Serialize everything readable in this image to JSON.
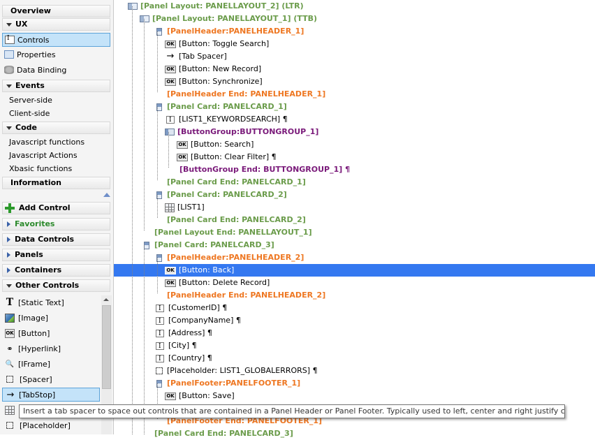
{
  "left": {
    "sections_top": [
      {
        "label": "Overview",
        "kind": "plain"
      },
      {
        "label": "UX",
        "kind": "open"
      }
    ],
    "ux_items": [
      {
        "label": "Controls",
        "icon": "controls-icon",
        "selected": true
      },
      {
        "label": "Properties",
        "icon": "properties-icon"
      },
      {
        "label": "Data Binding",
        "icon": "data-binding-icon"
      }
    ],
    "events_header": "Events",
    "events_items": [
      "Server-side",
      "Client-side"
    ],
    "code_header": "Code",
    "code_items": [
      "Javascript functions",
      "Javascript Actions",
      "Xbasic functions"
    ],
    "information": "Information",
    "add_control": "Add Control",
    "favorites": "Favorites",
    "groups": [
      "Data Controls",
      "Panels",
      "Containers"
    ],
    "other_controls": "Other Controls",
    "controls": [
      {
        "label": "[Static Text]",
        "icon": "static-text-icon"
      },
      {
        "label": "[Image]",
        "icon": "image-icon"
      },
      {
        "label": "[Button]",
        "icon": "button-icon"
      },
      {
        "label": "[Hyperlink]",
        "icon": "hyperlink-icon"
      },
      {
        "label": "[IFrame]",
        "icon": "iframe-icon"
      },
      {
        "label": "[Spacer]",
        "icon": "spacer-icon"
      },
      {
        "label": "[TabStop]",
        "icon": "tabstop-icon",
        "selected": true
      },
      {
        "label": "",
        "icon": "grid-icon"
      },
      {
        "label": "[Placeholder]",
        "icon": "placeholder-icon"
      }
    ]
  },
  "tree": [
    {
      "text": "[Panel Layout: PANELLAYOUT_2] (LTR)",
      "cls": "g",
      "icon": "panel"
    },
    {
      "text": "[Panel Layout: PANELLAYOUT_1] (TTB)",
      "cls": "g",
      "icon": "panel"
    },
    {
      "text": "[PanelHeader:PANELHEADER_1]",
      "cls": "o",
      "icon": "hdr"
    },
    {
      "text": "[Button: Toggle Search]",
      "cls": "",
      "icon": "ok"
    },
    {
      "text": "[Tab Spacer]",
      "cls": "",
      "icon": "arrow"
    },
    {
      "text": "[Button: New Record]",
      "cls": "",
      "icon": "ok"
    },
    {
      "text": "[Button: Synchronize]",
      "cls": "",
      "icon": "ok"
    },
    {
      "text": "[PanelHeader End: PANELHEADER_1]",
      "cls": "o",
      "icon": ""
    },
    {
      "text": "[Panel Card: PANELCARD_1]",
      "cls": "g",
      "icon": "hdr"
    },
    {
      "text": "[LIST1_KEYWORDSEARCH] ¶",
      "cls": "",
      "icon": "ctrl"
    },
    {
      "text": "[ButtonGroup:BUTTONGROUP_1]",
      "cls": "p",
      "icon": "btngrp"
    },
    {
      "text": "[Button: Search]",
      "cls": "",
      "icon": "ok"
    },
    {
      "text": "[Button: Clear Filter] ¶",
      "cls": "",
      "icon": "ok"
    },
    {
      "text": "[ButtonGroup End: BUTTONGROUP_1] ¶",
      "cls": "p",
      "icon": ""
    },
    {
      "text": "[Panel Card End: PANELCARD_1]",
      "cls": "g",
      "icon": ""
    },
    {
      "text": "[Panel Card: PANELCARD_2]",
      "cls": "g",
      "icon": "hdr"
    },
    {
      "text": "[LIST1]",
      "cls": "",
      "icon": "grid"
    },
    {
      "text": "[Panel Card End: PANELCARD_2]",
      "cls": "g",
      "icon": ""
    },
    {
      "text": "[Panel Layout End: PANELLAYOUT_1]",
      "cls": "g",
      "icon": ""
    },
    {
      "text": "[Panel Card: PANELCARD_3]",
      "cls": "g",
      "icon": "hdr"
    },
    {
      "text": "[PanelHeader:PANELHEADER_2]",
      "cls": "o",
      "icon": "hdr"
    },
    {
      "text": "[Button: Back]",
      "cls": "",
      "icon": "ok",
      "selected": true
    },
    {
      "text": "[Button: Delete Record]",
      "cls": "",
      "icon": "ok"
    },
    {
      "text": "[PanelHeader End: PANELHEADER_2]",
      "cls": "o",
      "icon": ""
    },
    {
      "text": "[CustomerID] ¶",
      "cls": "",
      "icon": "ctrl"
    },
    {
      "text": "[CompanyName] ¶",
      "cls": "",
      "icon": "ctrl"
    },
    {
      "text": "[Address] ¶",
      "cls": "",
      "icon": "ctrl"
    },
    {
      "text": "[City] ¶",
      "cls": "",
      "icon": "ctrl"
    },
    {
      "text": "[Country] ¶",
      "cls": "",
      "icon": "ctrl"
    },
    {
      "text": "[Placeholder: LIST1_GLOBALERRORS] ¶",
      "cls": "",
      "icon": "dash"
    },
    {
      "text": "[PanelFooter:PANELFOOTER_1]",
      "cls": "o",
      "icon": "hdr"
    },
    {
      "text": "[Button: Save]",
      "cls": "",
      "icon": "ok"
    },
    {
      "text": "",
      "cls": "",
      "icon": ""
    },
    {
      "text": "[PanelFooter End: PANELFOOTER_1]",
      "cls": "o",
      "icon": ""
    },
    {
      "text": "[Panel Card End: PANELCARD_3]",
      "cls": "g",
      "icon": ""
    }
  ],
  "tooltip": "Insert a tab spacer to space out controls that are contained in a Panel Header or Panel Footer. Typically used to left, center and right justify controls."
}
